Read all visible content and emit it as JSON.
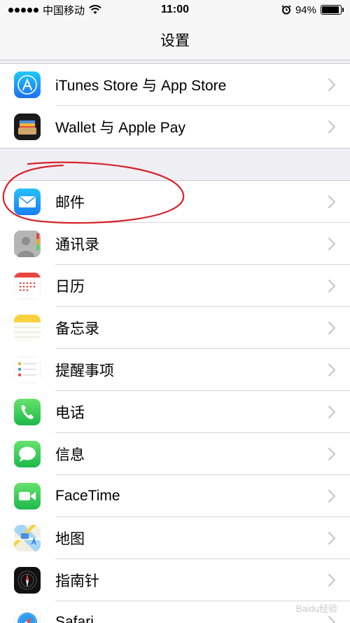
{
  "status_bar": {
    "carrier": "中国移动",
    "time": "11:00",
    "battery_percent_text": "94%",
    "battery_level": 0.94
  },
  "nav": {
    "title": "设置"
  },
  "group1": [
    {
      "label": "iTunes Store 与 App Store",
      "icon": "app-store-icon"
    },
    {
      "label": "Wallet 与 Apple Pay",
      "icon": "wallet-icon"
    }
  ],
  "group2": [
    {
      "label": "邮件",
      "icon": "mail-icon"
    },
    {
      "label": "通讯录",
      "icon": "contacts-icon"
    },
    {
      "label": "日历",
      "icon": "calendar-icon"
    },
    {
      "label": "备忘录",
      "icon": "notes-icon"
    },
    {
      "label": "提醒事项",
      "icon": "reminders-icon"
    },
    {
      "label": "电话",
      "icon": "phone-icon"
    },
    {
      "label": "信息",
      "icon": "messages-icon"
    },
    {
      "label": "FaceTime",
      "icon": "facetime-icon"
    },
    {
      "label": "地图",
      "icon": "maps-icon"
    },
    {
      "label": "指南针",
      "icon": "compass-icon"
    },
    {
      "label": "Safari",
      "icon": "safari-icon"
    }
  ],
  "watermark": "Baidu经验",
  "colors": {
    "annotation_red": "#d8232a",
    "chevron": "#c7c7cc"
  }
}
